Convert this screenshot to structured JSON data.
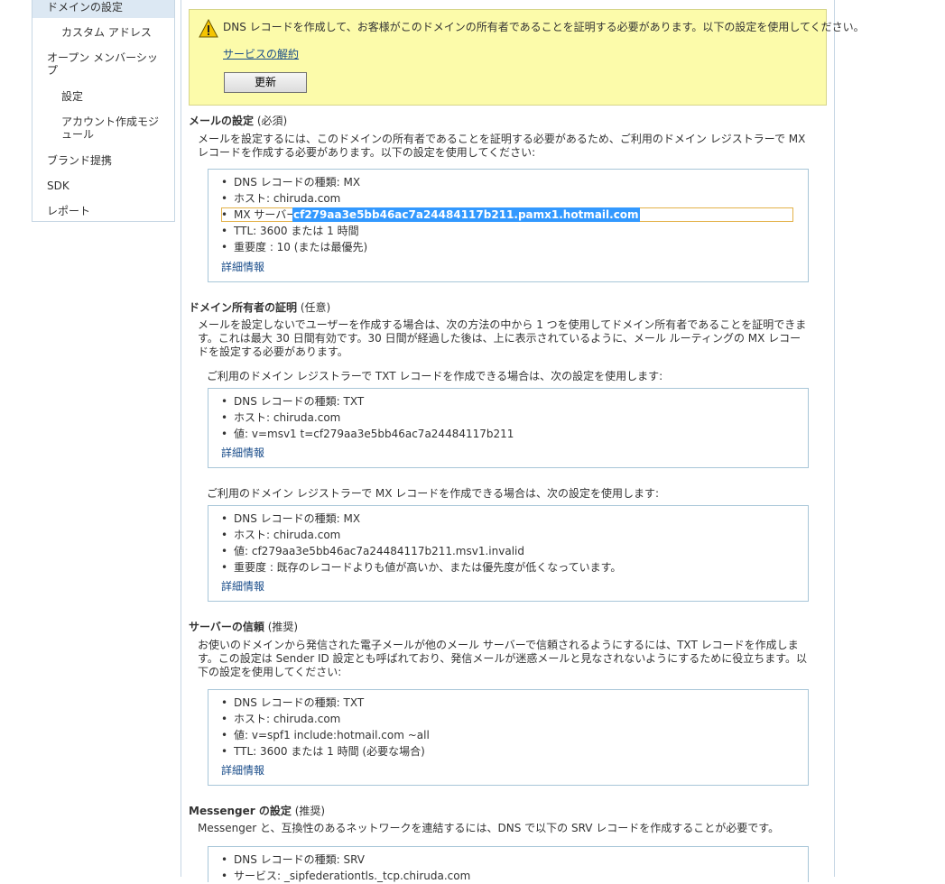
{
  "sidebar": {
    "items": [
      {
        "label": "ドメインの設定",
        "active": true
      },
      {
        "label": "カスタム アドレス"
      },
      {
        "label": "オープン メンバーシップ"
      },
      {
        "label": "設定"
      },
      {
        "label": "アカウント作成モジュール"
      },
      {
        "label": "ブランド提携"
      },
      {
        "label": "SDK"
      },
      {
        "label": "レポート"
      }
    ]
  },
  "notice": {
    "text": "DNS レコードを作成して、お客様がこのドメインの所有者であることを証明する必要があります。以下の設定を使用してください。",
    "link": "サービスの解約",
    "button": "更新"
  },
  "mail": {
    "title": "メールの設定",
    "tag": "(必須)",
    "desc": "メールを設定するには、このドメインの所有者であることを証明する必要があるため、ご利用のドメイン レジストラーで MX レコードを作成する必要があります。以下の設定を使用してください:",
    "items": [
      "DNS レコードの種類: MX",
      "ホスト: chiruda.com"
    ],
    "mx_label": "MX サーバー:",
    "mx_value": "cf279aa3e5bb46ac7a24484117b211.pamx1.hotmail.com",
    "items2": [
      "TTL: 3600 または 1 時間",
      "重要度 : 10 (または最優先)"
    ],
    "details": "詳細情報"
  },
  "ownership": {
    "title": "ドメイン所有者の証明",
    "tag": "(任意)",
    "desc": "メールを設定しないでユーザーを作成する場合は、次の方法の中から 1 つを使用してドメイン所有者であることを証明できます。これは最大 30 日間有効です。30 日間が経過した後は、上に表示されているように、メール ルーティングの MX レコードを設定する必要があります。",
    "txt_intro": "ご利用のドメイン レジストラーで TXT レコードを作成できる場合は、次の設定を使用します:",
    "txt_items": [
      "DNS レコードの種類: TXT",
      "ホスト: chiruda.com",
      "値: v=msv1 t=cf279aa3e5bb46ac7a24484117b211"
    ],
    "mx_intro": "ご利用のドメイン レジストラーで MX レコードを作成できる場合は、次の設定を使用します:",
    "mx_items": [
      "DNS レコードの種類: MX",
      "ホスト: chiruda.com",
      "値: cf279aa3e5bb46ac7a24484117b211.msv1.invalid",
      "重要度 : 既存のレコードよりも値が高いか、または優先度が低くなっています。"
    ],
    "details": "詳細情報"
  },
  "trust": {
    "title": "サーバーの信頼",
    "tag": "(推奨)",
    "desc": "お使いのドメインから発信された電子メールが他のメール サーバーで信頼されるようにするには、TXT レコードを作成します。この設定は Sender ID 設定とも呼ばれており、発信メールが迷惑メールと見なされないようにするために役立ちます。以下の設定を使用してください:",
    "items": [
      "DNS レコードの種類: TXT",
      "ホスト: chiruda.com",
      "値: v=spf1 include:hotmail.com ~all",
      "TTL: 3600 または 1 時間 (必要な場合)"
    ],
    "details": "詳細情報"
  },
  "messenger": {
    "title": "Messenger の設定",
    "tag": "(推奨)",
    "desc": "Messenger と、互換性のあるネットワークを連結するには、DNS で以下の SRV レコードを作成することが必要です。",
    "items": [
      "DNS レコードの種類: SRV",
      "サービス: _sipfederationtls._tcp.chiruda.com"
    ]
  }
}
